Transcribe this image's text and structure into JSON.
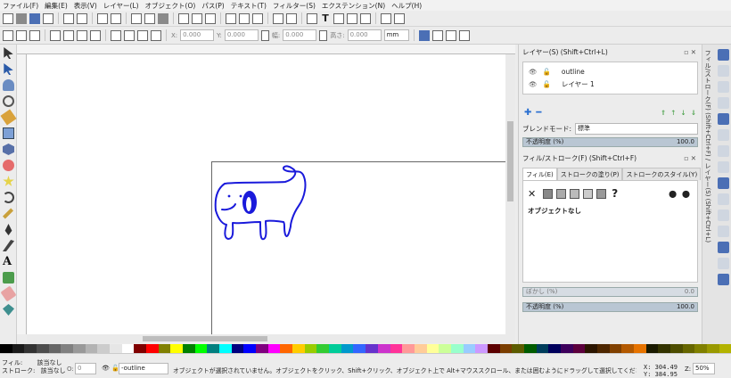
{
  "menu": [
    "ファイル(F)",
    "編集(E)",
    "表示(V)",
    "レイヤー(L)",
    "オブジェクト(O)",
    "パス(P)",
    "テキスト(T)",
    "フィルター(S)",
    "エクステンション(N)",
    "ヘルプ(H)"
  ],
  "toolbar2": {
    "x_label": "X:",
    "x_value": "0.000",
    "y_label": "Y:",
    "y_value": "0.000",
    "w_label": "幅:",
    "w_value": "0.000",
    "h_label": "高さ:",
    "h_value": "0.000",
    "unit": "mm"
  },
  "layers_panel": {
    "title": "レイヤー(S) (Shift+Ctrl+L)",
    "layers": [
      {
        "name": "outline"
      },
      {
        "name": "レイヤー 1"
      }
    ],
    "blend_label": "ブレンドモード:",
    "blend_value": "標準",
    "opacity_label": "不透明度 (%)",
    "opacity_value": "100.0"
  },
  "fill_panel": {
    "title": "フィル/ストローク(F) (Shift+Ctrl+F)",
    "tabs": [
      "フィル(E)",
      "ストロークの塗り(P)",
      "ストロークのスタイル(Y)"
    ],
    "no_object": "オブジェクトなし",
    "unknown_icon": "?",
    "blur_label": "ぼかし (%)",
    "blur_value": "0.0",
    "opacity_label": "不透明度 (%)",
    "opacity_value": "100.0"
  },
  "right_dock_text": "フィル/ストローク(F) (Shift+Ctrl+F) / レイヤー(S) (Shift+Ctrl+L)",
  "status": {
    "fill_label": "フィル:",
    "fill_value": "該当なし",
    "stroke_label": "ストローク:",
    "stroke_value": "該当なし",
    "o_label": "O:",
    "o_value": "0",
    "layer_select": "-outline",
    "message": "オブジェクトが選択されていません。オブジェクトをクリック、Shift+クリック、オブジェクト上で Alt+マウススクロール、または囲むようにドラッグして選択してください。",
    "x_label": "X:",
    "x_value": "304.49",
    "y_label": "Y:",
    "y_value": "384.95",
    "z_label": "Z:",
    "zoom": "50%"
  },
  "palette": [
    "#000000",
    "#1a1a1a",
    "#333333",
    "#4d4d4d",
    "#666666",
    "#808080",
    "#999999",
    "#b3b3b3",
    "#cccccc",
    "#e6e6e6",
    "#ffffff",
    "#800000",
    "#ff0000",
    "#808000",
    "#ffff00",
    "#008000",
    "#00ff00",
    "#008080",
    "#00ffff",
    "#000080",
    "#0000ff",
    "#800080",
    "#ff00ff",
    "#ff6600",
    "#ffcc00",
    "#99cc00",
    "#33cc33",
    "#00cc99",
    "#0099cc",
    "#3366ff",
    "#6633cc",
    "#cc33cc",
    "#ff3399",
    "#ff9999",
    "#ffcc99",
    "#ffff99",
    "#ccff99",
    "#99ffcc",
    "#99ccff",
    "#cc99ff",
    "#5c0000",
    "#7a3d00",
    "#5c5c00",
    "#005c00",
    "#003d5c",
    "#00005c",
    "#3d005c",
    "#5c003d",
    "#2b1500",
    "#4d2600",
    "#804000",
    "#b35900",
    "#e67300",
    "#1a1a00",
    "#333300",
    "#4d4d00",
    "#666600",
    "#808000",
    "#999900",
    "#b3b300"
  ],
  "colors": {
    "stroke": "#1a1adb",
    "page_border": "#666666"
  }
}
